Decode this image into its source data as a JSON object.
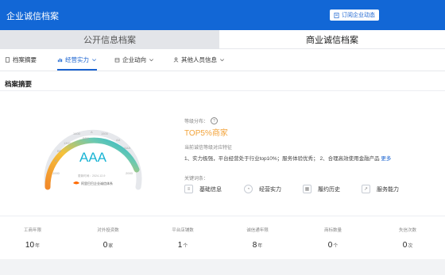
{
  "header": {
    "title": "企业诚信档案",
    "subscribe_label": "订阅企业动态"
  },
  "archive_tabs": [
    {
      "label": "公开信息档案"
    },
    {
      "label": "商业诚信档案"
    }
  ],
  "subnav": [
    {
      "label": "档案摘要"
    },
    {
      "label": "经营实力"
    },
    {
      "label": "企业动向"
    },
    {
      "label": "其他人员信息"
    }
  ],
  "summary": {
    "title": "档案摘要",
    "gauge": {
      "grade": "AAA",
      "scale": [
        "AAA",
        "AA",
        "A",
        "1500",
        "1400",
        "BBB",
        "1300",
        "BB",
        "B",
        "1000",
        "2000"
      ],
      "update_label": "更新时间：",
      "update_date": "2024-12-9",
      "brand": "阿里巴巴企业诚信体系"
    },
    "rating_label": "等级分布：",
    "rating_value": "TOP5%商家",
    "feature_title": "当前诚信等级对应特征",
    "feature_text": "1、实力极强，平台经营处于行业top10%；服务体验优秀；  2、合理高效使用金融产品",
    "more_label": "更多",
    "keywords_title": "关键词条：",
    "keywords": [
      {
        "label": "基础信息",
        "icon": "list-icon"
      },
      {
        "label": "经营实力",
        "icon": "chart-icon"
      },
      {
        "label": "履约历史",
        "icon": "grid-icon"
      },
      {
        "label": "服务能力",
        "icon": "trend-icon"
      }
    ]
  },
  "stats": [
    {
      "label": "工商年限",
      "value": "10",
      "unit": "年"
    },
    {
      "label": "对外投资数",
      "value": "0",
      "unit": "家"
    },
    {
      "label": "平台店铺数",
      "value": "1",
      "unit": "个"
    },
    {
      "label": "诚信通年限",
      "value": "8",
      "unit": "年"
    },
    {
      "label": "商标数量",
      "value": "0",
      "unit": "个"
    },
    {
      "label": "失信次数",
      "value": "0",
      "unit": "次"
    }
  ],
  "colors": {
    "primary": "#1267d6",
    "accent_orange": "#f2a33a",
    "gauge_teal": "#1ab4d4"
  }
}
